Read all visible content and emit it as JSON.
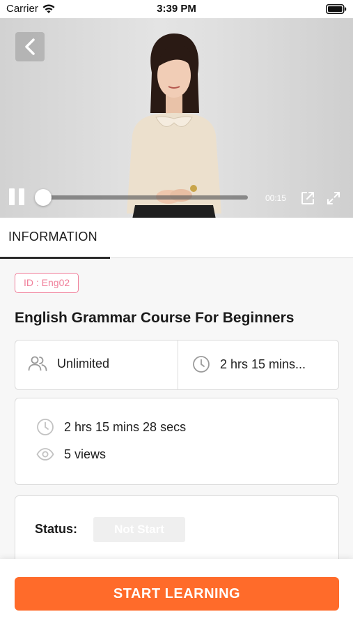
{
  "status_bar": {
    "carrier": "Carrier",
    "time": "3:39 PM"
  },
  "player": {
    "current_time": "00:15",
    "progress": 0.0,
    "back_icon": "chevron-left-icon",
    "pause_icon": "pause-icon",
    "popout_icon": "external-link-icon",
    "fullscreen_icon": "expand-icon"
  },
  "tabs": [
    {
      "label": "INFORMATION",
      "active": true
    }
  ],
  "course": {
    "id_badge": "ID : Eng02",
    "title": "English Grammar Course For Beginners",
    "capacity": "Unlimited",
    "duration_short": "2 hrs 15 mins...",
    "duration_full": "2 hrs 15 mins 28 secs",
    "views": "5 views",
    "status_label": "Status:",
    "status_value": "Not Start"
  },
  "actions": {
    "start_label": "START LEARNING"
  },
  "colors": {
    "accent": "#ff6b2a",
    "badge": "#f07f9a",
    "icon_gray": "#9a9a9a"
  }
}
